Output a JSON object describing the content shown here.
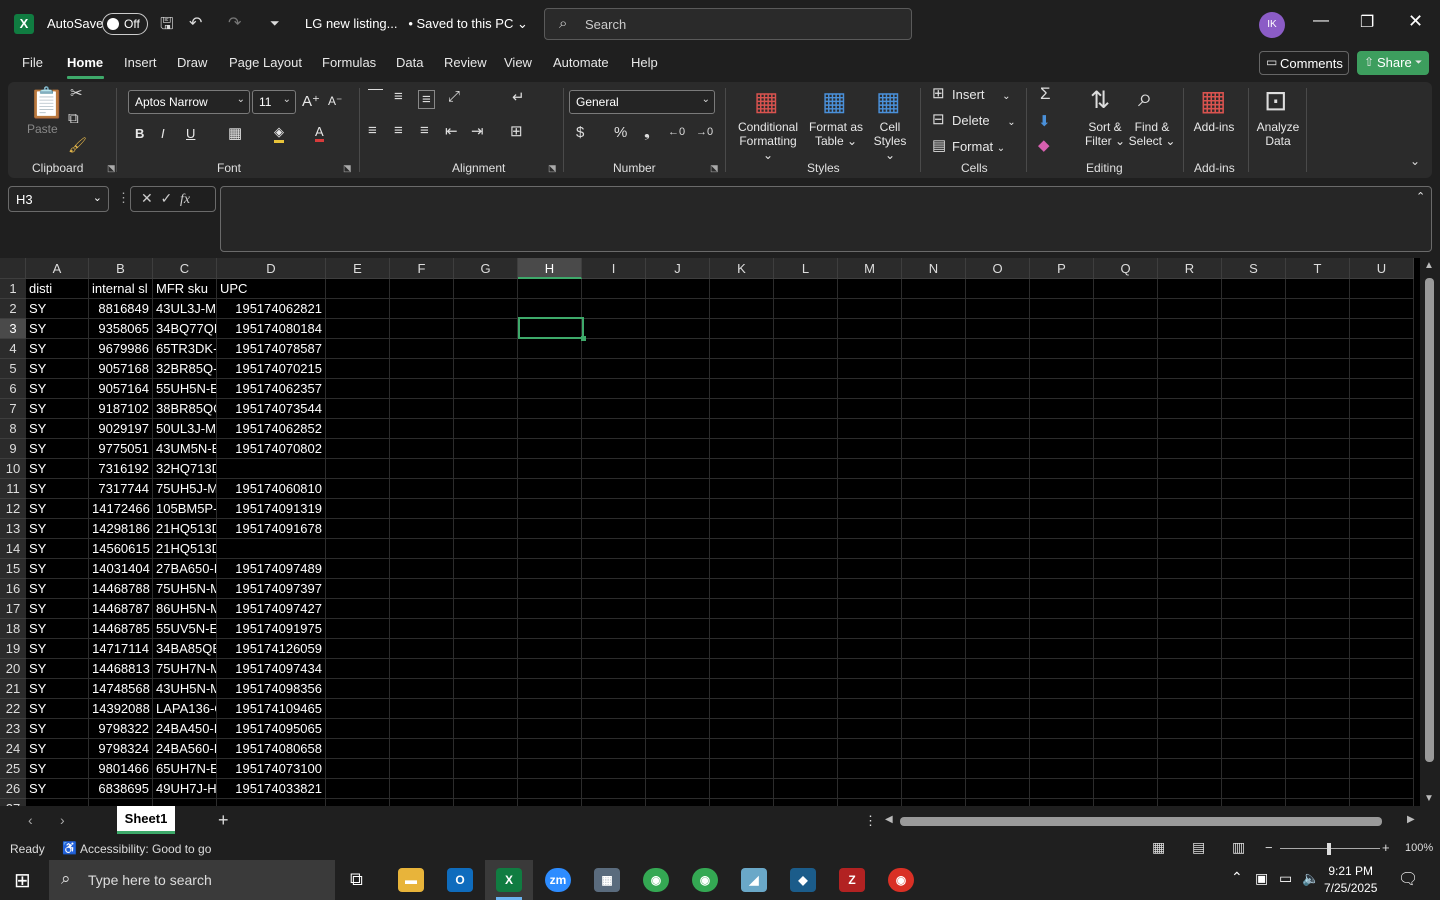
{
  "titlebar": {
    "autosave_label": "AutoSave",
    "autosave_state": "Off",
    "doc_title": "LG new listing...",
    "save_status": "• Saved to this PC",
    "search_placeholder": "Search",
    "avatar_initials": "IK"
  },
  "menu": [
    "File",
    "Home",
    "Insert",
    "Draw",
    "Page Layout",
    "Formulas",
    "Data",
    "Review",
    "View",
    "Automate",
    "Help"
  ],
  "comments_label": "Comments",
  "share_label": "Share",
  "ribbon": {
    "clipboard": {
      "paste": "Paste",
      "group": "Clipboard"
    },
    "font": {
      "name": "Aptos Narrow",
      "size": "11",
      "group": "Font"
    },
    "alignment": {
      "group": "Alignment"
    },
    "number": {
      "format": "General",
      "group": "Number"
    },
    "styles": {
      "conditional": "Conditional",
      "conditional2": "Formatting",
      "format_as": "Format as",
      "format_as2": "Table",
      "cell": "Cell",
      "cell2": "Styles",
      "group": "Styles"
    },
    "cells": {
      "insert": "Insert",
      "delete": "Delete",
      "format": "Format",
      "group": "Cells"
    },
    "editing": {
      "sort": "Sort &",
      "sort2": "Filter",
      "find": "Find &",
      "find2": "Select",
      "group": "Editing"
    },
    "addins": {
      "label": "Add-ins",
      "group": "Add-ins"
    },
    "analyze": {
      "l1": "Analyze",
      "l2": "Data"
    }
  },
  "name_box": "H3",
  "columns": [
    "A",
    "B",
    "C",
    "D",
    "E",
    "F",
    "G",
    "H",
    "I",
    "J",
    "K",
    "L",
    "M",
    "N",
    "O",
    "P",
    "Q",
    "R",
    "S",
    "T",
    "U"
  ],
  "rows": [
    [
      "disti",
      "internal sl",
      "MFR sku",
      "UPC"
    ],
    [
      "SY",
      "8816849",
      "43UL3J-M",
      "195174062821"
    ],
    [
      "SY",
      "9358065",
      "34BQ77QE",
      "195174080184"
    ],
    [
      "SY",
      "9679986",
      "65TR3DK-E",
      "195174078587"
    ],
    [
      "SY",
      "9057168",
      "32BR85Q-I",
      "195174070215"
    ],
    [
      "SY",
      "9057164",
      "55UH5N-E",
      "195174062357"
    ],
    [
      "SY",
      "9187102",
      "38BR85QC",
      "195174073544"
    ],
    [
      "SY",
      "9029197",
      "50UL3J-M",
      "195174062852"
    ],
    [
      "SY",
      "9775051",
      "43UM5N-E",
      "195174070802"
    ],
    [
      "SY",
      "7316192",
      "32HQ713D",
      ""
    ],
    [
      "SY",
      "7317744",
      "75UH5J-M",
      "195174060810"
    ],
    [
      "SY",
      "14172466",
      "105BM5P-",
      "195174091319"
    ],
    [
      "SY",
      "14298186",
      "21HQ513D",
      "195174091678"
    ],
    [
      "SY",
      "14560615",
      "21HQ513D",
      ""
    ],
    [
      "SY",
      "14031404",
      "27BA650-E",
      "195174097489"
    ],
    [
      "SY",
      "14468788",
      "75UH5N-M",
      "195174097397"
    ],
    [
      "SY",
      "14468787",
      "86UH5N-M",
      "195174097427"
    ],
    [
      "SY",
      "14468785",
      "55UV5N-E",
      "195174091975"
    ],
    [
      "SY",
      "14717114",
      "34BA85QE",
      "195174126059"
    ],
    [
      "SY",
      "14468813",
      "75UH7N-M",
      "195174097434"
    ],
    [
      "SY",
      "14748568",
      "43UH5N-M",
      "195174098356"
    ],
    [
      "SY",
      "14392088",
      "LAPA136-C",
      "195174109465"
    ],
    [
      "SY",
      "9798322",
      "24BA450-E",
      "195174095065"
    ],
    [
      "SY",
      "9798324",
      "24BA560-E",
      "195174080658"
    ],
    [
      "SY",
      "9801466",
      "65UH7N-E",
      "195174073100"
    ],
    [
      "SY",
      "6838695",
      "49UH7J-H",
      "195174033821"
    ]
  ],
  "sheet_tab": "Sheet1",
  "status": {
    "ready": "Ready",
    "accessibility": "Accessibility: Good to go",
    "zoom": "100%"
  },
  "taskbar": {
    "search": "Type here to search",
    "time": "9:21 PM",
    "date": "7/25/2025"
  }
}
